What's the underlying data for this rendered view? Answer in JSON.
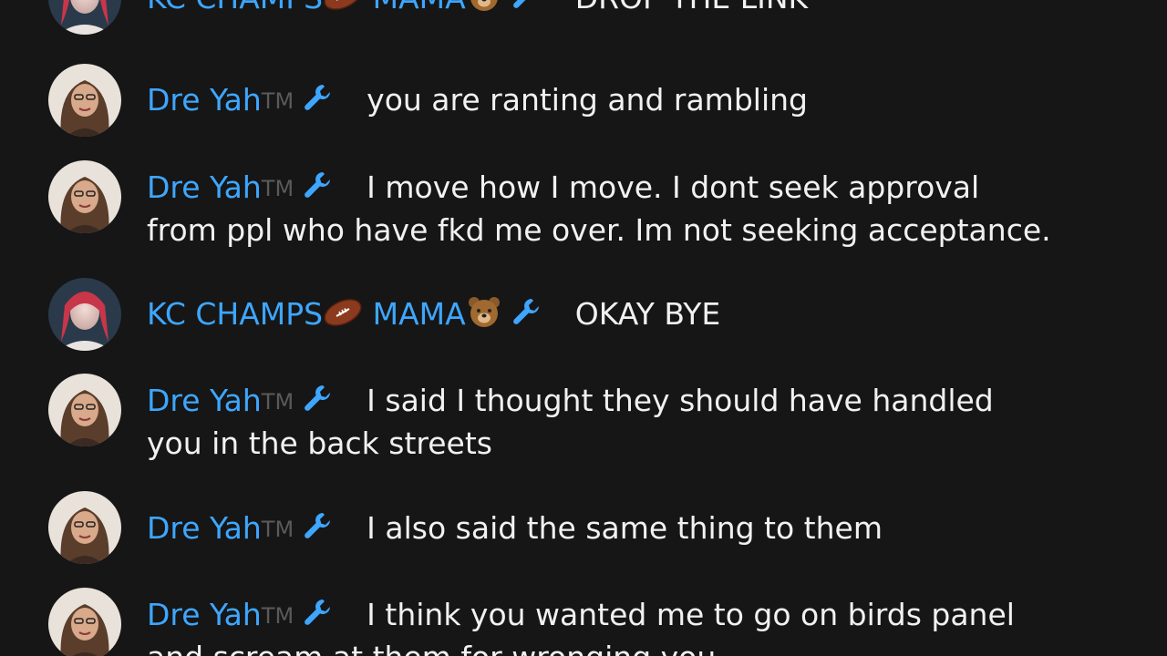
{
  "messages": [
    {
      "author": "KC CHAMPS",
      "author_part2": "MAMA",
      "badge": "wrench-icon",
      "text": "DROP THE LINK",
      "avatar": "avatar-kc"
    },
    {
      "author": "Dre Yah",
      "tm": "TM",
      "badge": "wrench-icon",
      "text": "you are ranting and rambling",
      "avatar": "avatar-dre"
    },
    {
      "author": "Dre Yah",
      "tm": "TM",
      "badge": "wrench-icon",
      "text": "I move how I move. I dont seek approval",
      "text_line2": "from ppl who have fkd me over. Im not seeking acceptance.",
      "avatar": "avatar-dre"
    },
    {
      "author": "KC CHAMPS",
      "author_part2": "MAMA",
      "badge": "wrench-icon",
      "text": "OKAY BYE",
      "avatar": "avatar-kc"
    },
    {
      "author": "Dre Yah",
      "tm": "TM",
      "badge": "wrench-icon",
      "text": "I said I thought they should have handled",
      "text_line2": "you in the back streets",
      "avatar": "avatar-dre"
    },
    {
      "author": "Dre Yah",
      "tm": "TM",
      "badge": "wrench-icon",
      "text": "I also said the same thing to them",
      "avatar": "avatar-dre"
    },
    {
      "author": "Dre Yah",
      "tm": "TM",
      "badge": "wrench-icon",
      "text": "I think you wanted me to go on birds panel",
      "text_line2": "and scream at them for wronging you",
      "avatar": "avatar-dre"
    }
  ],
  "colors": {
    "background": "#161616",
    "author": "#3ea6ff",
    "text": "#f1f1f1",
    "tm": "#5a5a5a"
  }
}
